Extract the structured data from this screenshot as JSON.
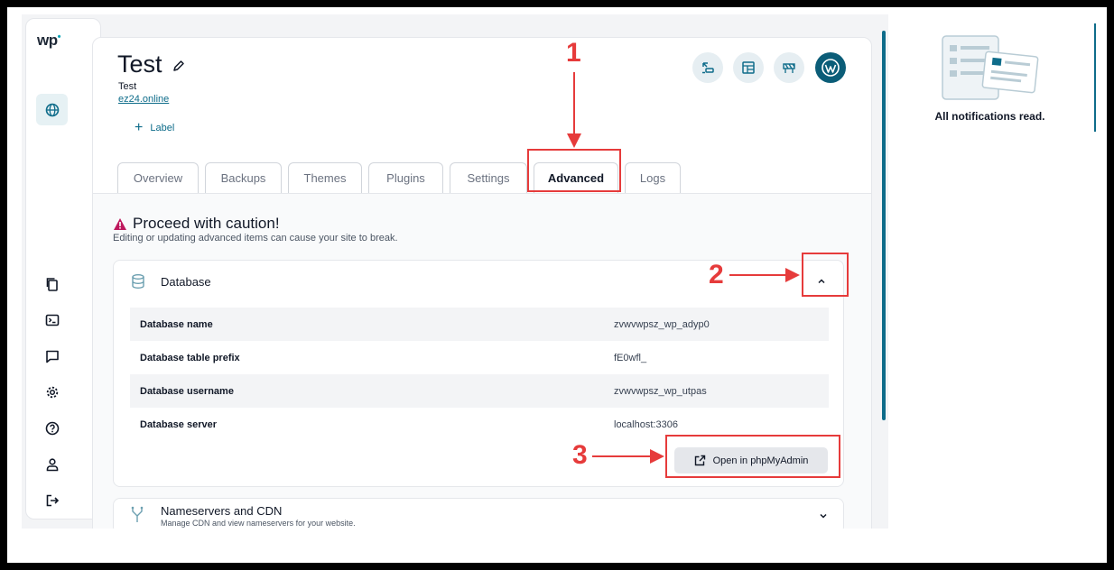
{
  "brand": {
    "logo": "wp"
  },
  "rail": {
    "active_icon": "globe-icon",
    "icons": [
      "copy-icon",
      "terminal-icon",
      "chat-icon",
      "gear-icon",
      "help-icon",
      "user-icon",
      "logout-icon"
    ]
  },
  "site": {
    "title": "Test",
    "subtitle": "Test",
    "domain": "ez24.online",
    "label_button": "Label"
  },
  "header_actions": [
    "migrate-icon",
    "layout-icon",
    "staging-icon",
    "wordpress-icon"
  ],
  "tabs": [
    {
      "label": "Overview"
    },
    {
      "label": "Backups"
    },
    {
      "label": "Themes"
    },
    {
      "label": "Plugins"
    },
    {
      "label": "Settings"
    },
    {
      "label": "Advanced",
      "active": true
    },
    {
      "label": "Logs"
    }
  ],
  "caution": {
    "title": "Proceed with caution!",
    "subtitle": "Editing or updating advanced items can cause your site to break."
  },
  "database": {
    "title": "Database",
    "rows": [
      {
        "key": "Database name",
        "value": "zvwvwpsz_wp_adyp0"
      },
      {
        "key": "Database table prefix",
        "value": "fE0wfl_"
      },
      {
        "key": "Database username",
        "value": "zvwvwpsz_wp_utpas"
      },
      {
        "key": "Database server",
        "value": "localhost:3306"
      }
    ],
    "phpmyadmin_button": "Open in phpMyAdmin"
  },
  "nameservers": {
    "title": "Nameservers and CDN",
    "subtitle": "Manage CDN and view nameservers for your website."
  },
  "notifications": {
    "empty_text": "All notifications read."
  },
  "annotations": {
    "one": "1",
    "two": "2",
    "three": "3"
  },
  "colors": {
    "accent": "#0e6c8a",
    "annotation": "#e63b3b",
    "warning": "#be185d"
  }
}
